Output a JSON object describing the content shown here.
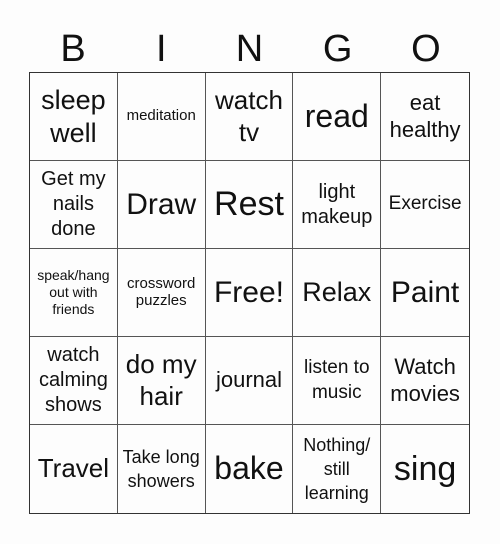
{
  "header": {
    "letters": [
      "B",
      "I",
      "N",
      "G",
      "O"
    ]
  },
  "cells": [
    "sleep well",
    "meditation",
    "watch tv",
    "read",
    "eat healthy",
    "Get my nails done",
    "Draw",
    "Rest",
    "light makeup",
    "Exercise",
    "speak/hang out with friends",
    "crossword puzzles",
    "Free!",
    "Relax",
    "Paint",
    "watch calming shows",
    "do my hair",
    "journal",
    "listen to music",
    "Watch movies",
    "Travel",
    "Take long showers",
    "bake",
    "Nothing/ still learning",
    "sing"
  ]
}
